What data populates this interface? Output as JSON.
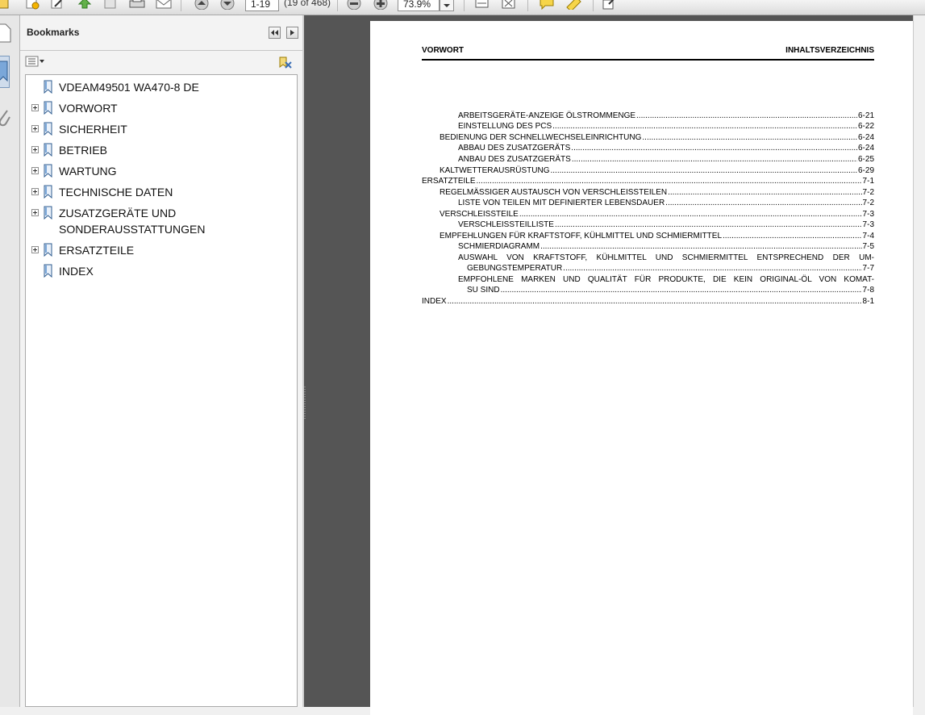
{
  "toolbar": {
    "page_value": "1-19",
    "page_count": "(19 of 468)",
    "zoom_value": "73.9%"
  },
  "bookmarks_panel": {
    "title": "Bookmarks",
    "items": [
      {
        "label": "VDEAM49501 WA470-8 DE",
        "expandable": false
      },
      {
        "label": "VORWORT",
        "expandable": true
      },
      {
        "label": "SICHERHEIT",
        "expandable": true
      },
      {
        "label": "BETRIEB",
        "expandable": true
      },
      {
        "label": "WARTUNG",
        "expandable": true
      },
      {
        "label": "TECHNISCHE DATEN",
        "expandable": true
      },
      {
        "label": "ZUSATZGERÄTE UND SONDERAUSSTATTUNGEN",
        "expandable": true
      },
      {
        "label": "ERSATZTEILE",
        "expandable": true
      },
      {
        "label": "INDEX",
        "expandable": false
      }
    ]
  },
  "document": {
    "header_left": "VORWORT",
    "header_right": "INHALTSVERZEICHNIS",
    "toc": [
      {
        "title": "ARBEITSGERÄTE-ANZEIGE ÖLSTROMMENGE",
        "page": "6-21"
      },
      {
        "title": "EINSTELLUNG DES PCS",
        "page": "6-22"
      },
      {
        "title": "BEDIENUNG DER SCHNELLWECHSELEINRICHTUNG",
        "page": "6-24"
      },
      {
        "title": "ABBAU DES ZUSATZGERÄTS",
        "page": "6-24"
      },
      {
        "title": "ANBAU DES ZUSATZGERÄTS",
        "page": "6-25"
      },
      {
        "title": "KALTWETTERAUSRÜSTUNG",
        "page": "6-29"
      },
      {
        "title": "ERSATZTEILE",
        "page": "7-1"
      },
      {
        "title": "REGELMÄSSIGER AUSTAUSCH VON VERSCHLEISSTEILEN",
        "page": "7-2"
      },
      {
        "title": "LISTE VON TEILEN MIT DEFINIERTER LEBENSDAUER",
        "page": "7-2"
      },
      {
        "title": "VERSCHLEISSTEILE",
        "page": "7-3"
      },
      {
        "title": "VERSCHLEISSTEILLISTE",
        "page": "7-3"
      },
      {
        "title": "EMPFEHLUNGEN FÜR KRAFTSTOFF, KÜHLMITTEL UND SCHMIERMITTEL",
        "page": "7-4"
      },
      {
        "title": "SCHMIERDIAGRAMM",
        "page": "7-5"
      },
      {
        "title_line1": "AUSWAHL VON KRAFTSTOFF, KÜHLMITTEL UND SCHMIERMITTEL ENTSPRECHEND DER UM-",
        "title": "GEBUNGSTEMPERATUR",
        "page": "7-7"
      },
      {
        "title_line1": "EMPFOHLENE MARKEN UND QUALITÄT FÜR PRODUKTE, DIE KEIN ORIGINAL-ÖL VON KOMAT-",
        "title": "SU SIND",
        "page": "7-8"
      },
      {
        "title": "INDEX",
        "page": "8-1"
      }
    ]
  }
}
